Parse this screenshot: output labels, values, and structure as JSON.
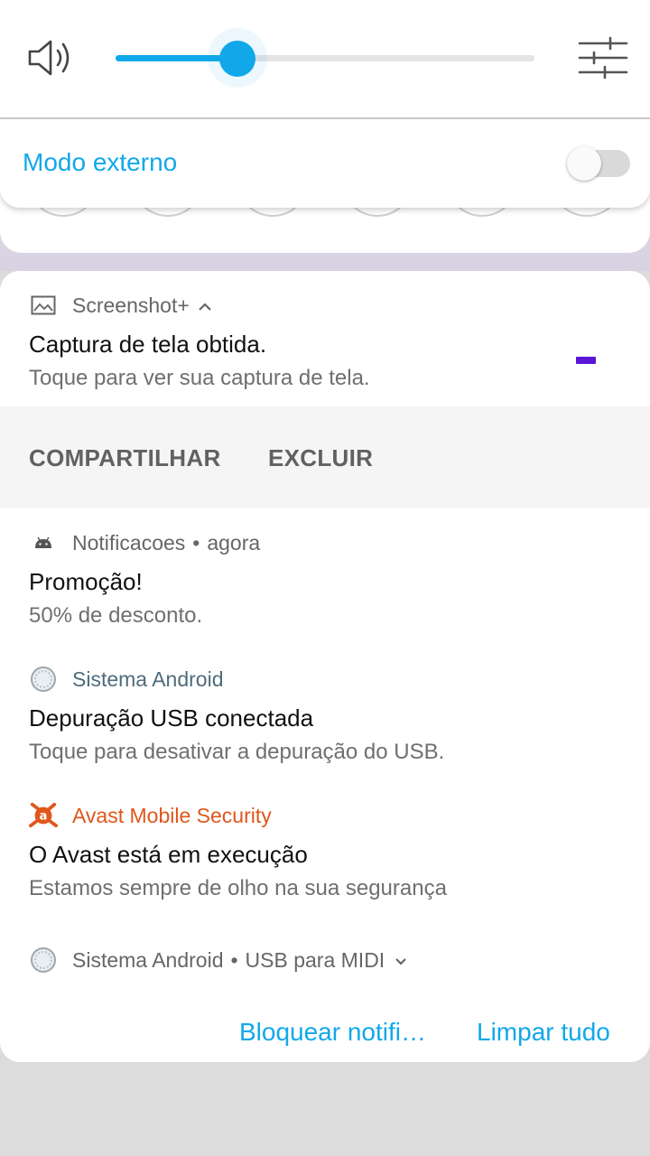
{
  "volume": {
    "level": 0.29,
    "mode_label": "Modo externo",
    "mode_enabled": false
  },
  "notifications": [
    {
      "app": "Screenshot+",
      "title": "Captura de tela obtida.",
      "text": "Toque para ver sua captura de tela.",
      "actions": [
        "COMPARTILHAR",
        "EXCLUIR"
      ]
    },
    {
      "app": "Notificacoes",
      "time": "agora",
      "title": "Promoção!",
      "text": "50% de desconto."
    },
    {
      "app": "Sistema Android",
      "title": "Depuração USB conectada",
      "text": "Toque para desativar a depuração do USB."
    },
    {
      "app": "Avast Mobile Security",
      "title": "O Avast está em execução",
      "text": "Estamos sempre de olho na sua segurança"
    },
    {
      "app": "Sistema Android",
      "subtext": "USB para MIDI"
    }
  ],
  "footer": {
    "block_label": "Bloquear notifi…",
    "clear_label": "Limpar tudo"
  },
  "colors": {
    "accent": "#11a8ea",
    "avast": "#e0561b",
    "android_app": "#4f6b7a"
  },
  "icons": {
    "volume": "speaker-icon",
    "settings": "sliders-icon",
    "screenshot": "image-icon",
    "notificacoes": "android-icon",
    "android_system": "system-gear-icon",
    "avast": "avast-icon"
  }
}
